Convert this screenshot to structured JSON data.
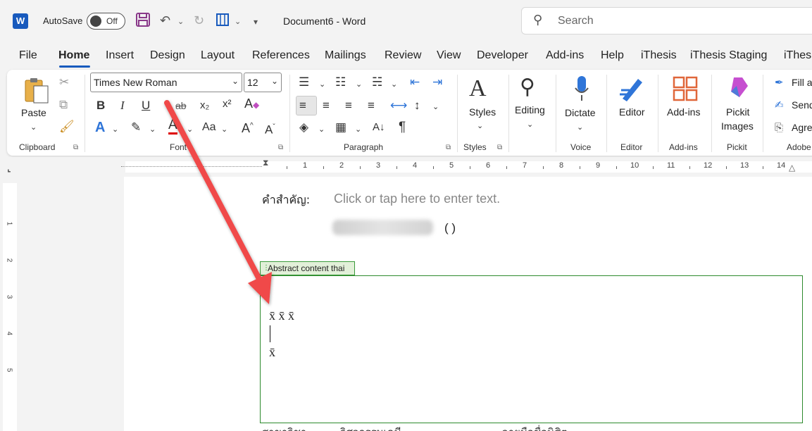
{
  "titlebar": {
    "app_icon": "W",
    "autosave_label": "AutoSave",
    "autosave_state": "Off",
    "doc_title": "Document6  -  Word",
    "search_placeholder": "Search"
  },
  "tabs": [
    "File",
    "Home",
    "Insert",
    "Design",
    "Layout",
    "References",
    "Mailings",
    "Review",
    "View",
    "Developer",
    "Add-ins",
    "Help",
    "iThesis",
    "iThesis Staging",
    "iThes"
  ],
  "active_tab": "Home",
  "ribbon": {
    "clipboard": {
      "paste": "Paste",
      "label": "Clipboard"
    },
    "font": {
      "name": "Times New Roman",
      "size": "12",
      "label": "Font",
      "bold": "B",
      "italic": "I",
      "underline": "U",
      "strike": "ab",
      "sub": "x₂",
      "sup": "x²",
      "case": "Aa",
      "grow": "A^",
      "shrink": "Aˇ"
    },
    "paragraph": {
      "label": "Paragraph",
      "pilcrow": "¶"
    },
    "styles": {
      "button": "Styles",
      "label": "Styles"
    },
    "editing": {
      "button": "Editing"
    },
    "voice": {
      "button": "Dictate",
      "label": "Voice"
    },
    "editor": {
      "button": "Editor",
      "label": "Editor"
    },
    "addins": {
      "button": "Add-ins",
      "label": "Add-ins"
    },
    "pickit": {
      "button_line1": "Pickit",
      "button_line2": "Images",
      "label": "Pickit"
    },
    "adobe": {
      "item1": "Fill a",
      "item2": "Send",
      "item3": "Agre",
      "label": "Adobe"
    }
  },
  "ruler": {
    "h_ticks": [
      "1",
      "2",
      "3",
      "4",
      "5",
      "6",
      "7",
      "8",
      "9",
      "10",
      "11",
      "12",
      "13",
      "14"
    ],
    "v_ticks": [
      "1",
      "2",
      "3",
      "4",
      "5"
    ]
  },
  "document": {
    "keyword_label": "คำสำคัญ:",
    "keyword_placeholder": "Click or tap here to enter text.",
    "paren": "( )",
    "content_control_tag": "Abstract content thai",
    "line1": "x̄ x̄ x̄",
    "line3": "x̄",
    "footer_partial": "สาขาวิชา          วิศวกรรมเคมี                              ลายมือชื่อนิสิต"
  },
  "colors": {
    "accent": "#185abd",
    "cc_border": "#2d8a2d",
    "cc_tag_bg": "#e2f0d9",
    "arrow": "#f04a4a"
  }
}
